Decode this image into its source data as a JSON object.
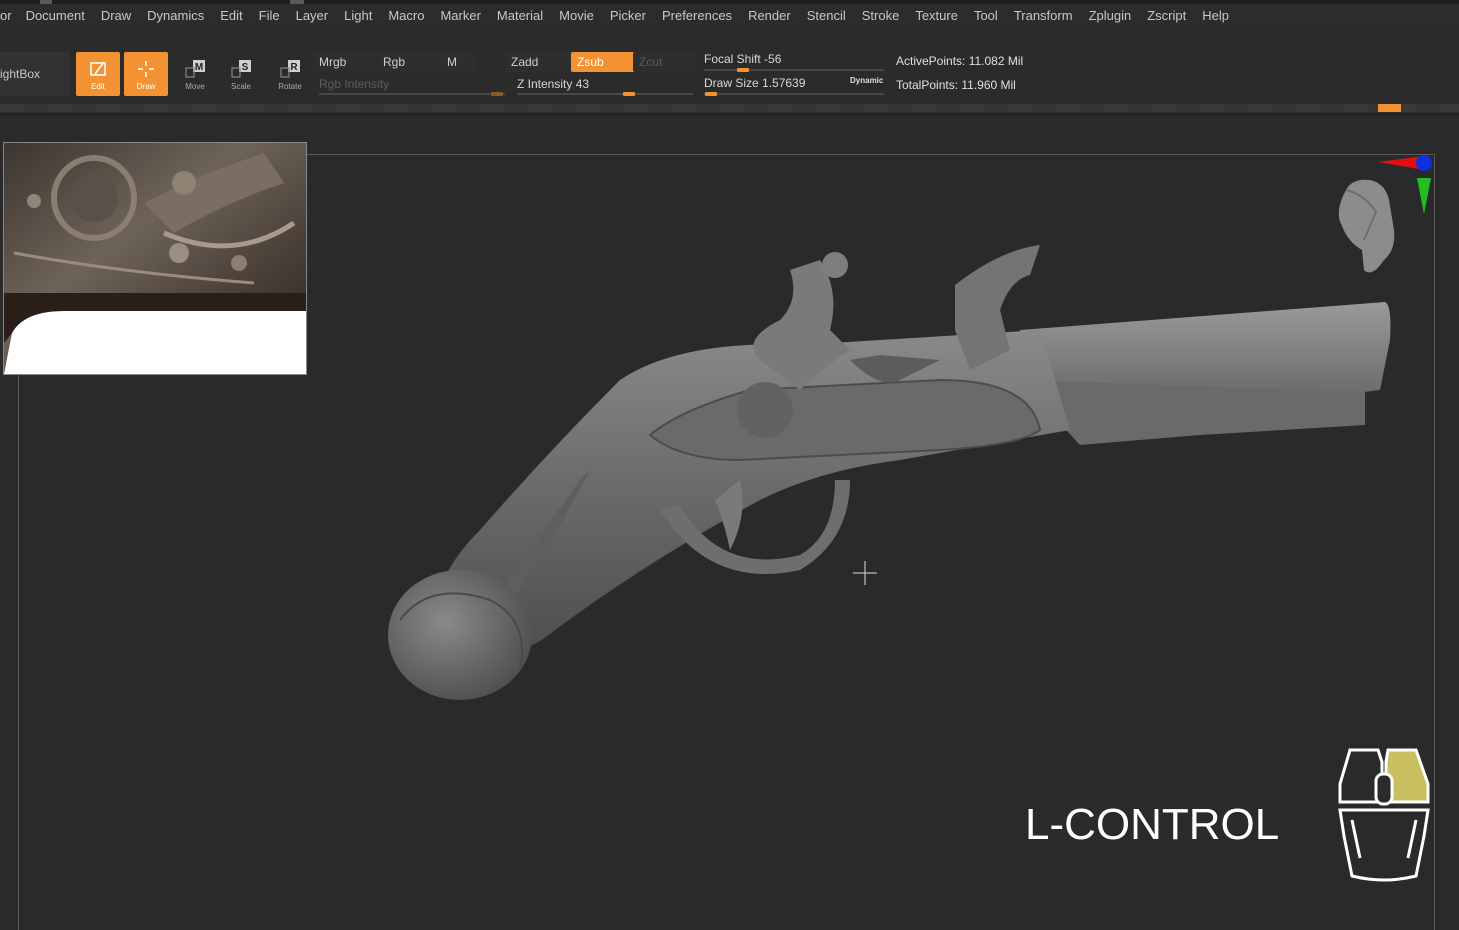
{
  "menu": [
    "or",
    "Document",
    "Draw",
    "Dynamics",
    "Edit",
    "File",
    "Layer",
    "Light",
    "Macro",
    "Marker",
    "Material",
    "Movie",
    "Picker",
    "Preferences",
    "Render",
    "Stencil",
    "Stroke",
    "Texture",
    "Tool",
    "Transform",
    "Zplugin",
    "Zscript",
    "Help"
  ],
  "shelf": {
    "lightbox": "ightBox",
    "tools": [
      {
        "label": "Edit",
        "icon": "edit-icon",
        "active": true
      },
      {
        "label": "Draw",
        "icon": "draw-icon",
        "active": true
      },
      {
        "label": "Move",
        "icon": "move-icon",
        "active": false
      },
      {
        "label": "Scale",
        "icon": "scale-icon",
        "active": false
      },
      {
        "label": "Rotate",
        "icon": "rotate-icon",
        "active": false
      }
    ],
    "mrgb": "Mrgb",
    "rgb": "Rgb",
    "m": "M",
    "rgb_intensity": "Rgb Intensity",
    "zadd": "Zadd",
    "zsub": "Zsub",
    "zcut": "Zcut",
    "z_intensity": "Z Intensity 43",
    "focal_shift": "Focal Shift -56",
    "draw_size": "Draw Size 1.57639",
    "dynamic": "Dynamic",
    "active_points": "ActivePoints: 11.082 Mil",
    "total_points": "TotalPoints: 11.960 Mil"
  },
  "viewport": {
    "key_hint": "L-CONTROL"
  },
  "colors": {
    "accent": "#f29232",
    "gizmo_x": "#e01010",
    "gizmo_y": "#20c020",
    "gizmo_z": "#1030e0",
    "mouse_highlight": "#c8c060"
  }
}
